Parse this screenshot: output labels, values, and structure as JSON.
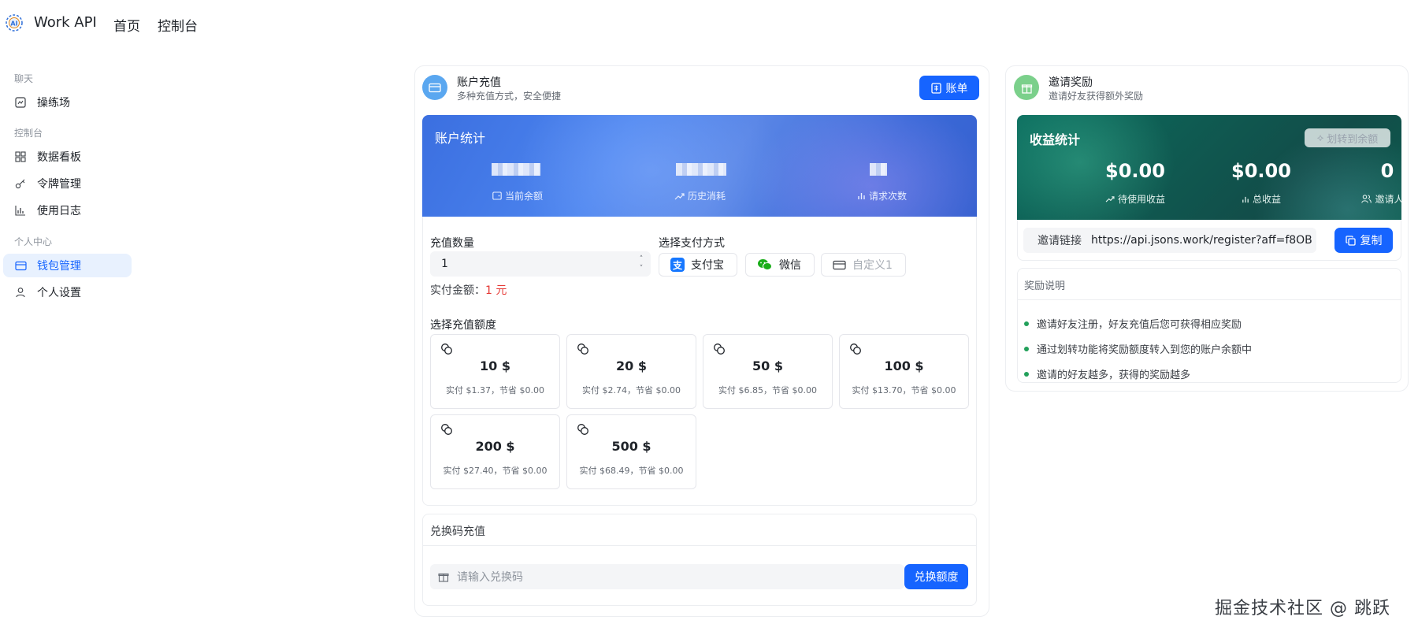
{
  "header": {
    "brand": "Work API",
    "logo_text": "AI",
    "nav": [
      "首页",
      "控制台"
    ]
  },
  "sidebar": {
    "sections": [
      "聊天",
      "控制台",
      "个人中心"
    ],
    "items": [
      {
        "label": "操练场",
        "icon": "playground-icon",
        "active": false
      },
      {
        "label": "数据看板",
        "icon": "dashboard-icon",
        "active": false
      },
      {
        "label": "令牌管理",
        "icon": "key-icon",
        "active": false
      },
      {
        "label": "使用日志",
        "icon": "chart-icon",
        "active": false
      },
      {
        "label": "钱包管理",
        "icon": "wallet-icon",
        "active": true
      },
      {
        "label": "个人设置",
        "icon": "user-icon",
        "active": false
      }
    ]
  },
  "recharge": {
    "title": "账户充值",
    "subtitle": "多种充值方式，安全便捷",
    "bill_button": "账单",
    "stats": {
      "title": "账户统计",
      "items": [
        "当前余额",
        "历史消耗",
        "请求次数"
      ]
    },
    "quantity_label": "充值数量",
    "quantity_value": "1",
    "payment_label": "选择支付方式",
    "payments": [
      "支付宝",
      "微信",
      "自定义1"
    ],
    "real_amount_label": "实付金额：",
    "real_amount_value": "1 元",
    "amount_label": "选择充值额度",
    "amounts": [
      {
        "value": "10 $",
        "sub": "实付 $1.37，节省 $0.00"
      },
      {
        "value": "20 $",
        "sub": "实付 $2.74，节省 $0.00"
      },
      {
        "value": "50 $",
        "sub": "实付 $6.85，节省 $0.00"
      },
      {
        "value": "100 $",
        "sub": "实付 $13.70，节省 $0.00"
      },
      {
        "value": "200 $",
        "sub": "实付 $27.40，节省 $0.00"
      },
      {
        "value": "500 $",
        "sub": "实付 $68.49，节省 $0.00"
      }
    ],
    "redeem_title": "兑换码充值",
    "redeem_placeholder": "请输入兑换码",
    "redeem_button": "兑换额度"
  },
  "invite": {
    "title": "邀请奖励",
    "subtitle": "邀请好友获得额外奖励",
    "stats_title": "收益统计",
    "transfer_button": "划转到余额",
    "values": [
      {
        "value": "$0.00",
        "label": "待使用收益"
      },
      {
        "value": "$0.00",
        "label": "总收益"
      },
      {
        "value": "0",
        "label": "邀请人数"
      }
    ],
    "link_label": "邀请链接",
    "link_value": "https://api.jsons.work/register?aff=f8OB",
    "copy_button": "复制",
    "rules_title": "奖励说明",
    "rules": [
      "邀请好友注册，好友充值后您可获得相应奖励",
      "通过划转功能将奖励额度转入到您的账户余额中",
      "邀请的好友越多，获得的奖励越多"
    ]
  },
  "watermark": "掘金技术社区 @ 跳跃",
  "colors": {
    "primary": "#1664ff",
    "blue_panel": "#4d85ef",
    "green_panel": "#0f5a51",
    "accent_red": "#e53935"
  }
}
